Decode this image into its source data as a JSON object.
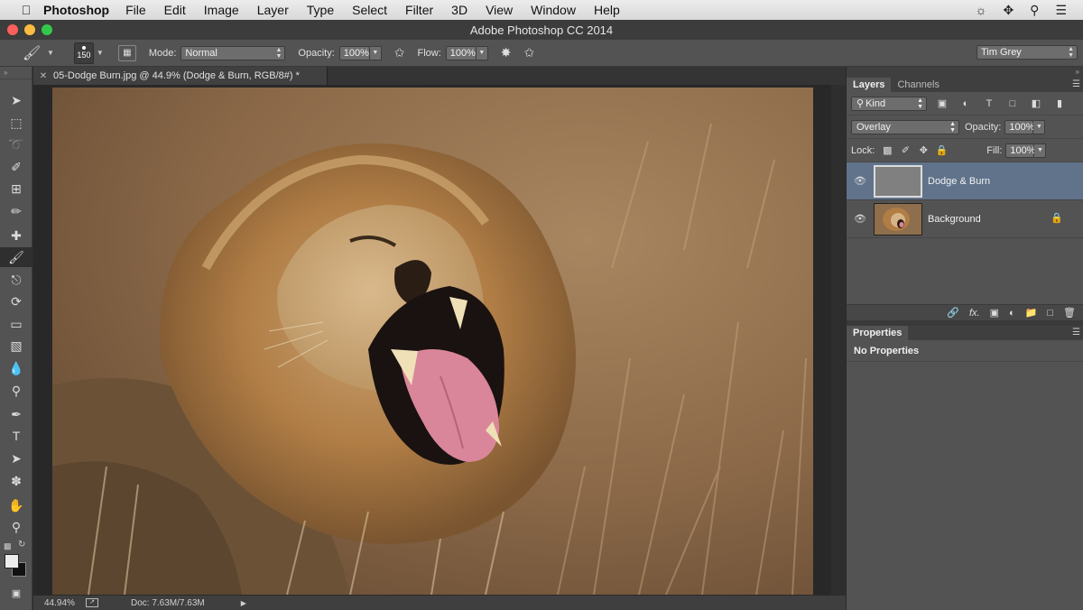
{
  "menubar": {
    "app_name": "Photoshop",
    "items": [
      "File",
      "Edit",
      "Image",
      "Layer",
      "Type",
      "Select",
      "Filter",
      "3D",
      "View",
      "Window",
      "Help"
    ]
  },
  "window": {
    "title": "Adobe Photoshop CC 2014"
  },
  "options": {
    "brush_size": "150",
    "mode_label": "Mode:",
    "mode_value": "Normal",
    "opacity_label": "Opacity:",
    "opacity_value": "100%",
    "flow_label": "Flow:",
    "flow_value": "100%",
    "workspace": "Tim Grey"
  },
  "document": {
    "tab_title": "05-Dodge Burn.jpg @ 44.9% (Dodge & Burn, RGB/8#) *",
    "zoom": "44.94%",
    "doc_size": "Doc: 7.63M/7.63M"
  },
  "layers_panel": {
    "tabs": [
      "Layers",
      "Channels"
    ],
    "kind_filter": "Kind",
    "blend_mode": "Overlay",
    "opacity_label": "Opacity:",
    "opacity_value": "100%",
    "lock_label": "Lock:",
    "fill_label": "Fill:",
    "fill_value": "100%",
    "layers": [
      {
        "name": "Dodge & Burn",
        "selected": true,
        "locked": false
      },
      {
        "name": "Background",
        "selected": false,
        "locked": true
      }
    ]
  },
  "properties_panel": {
    "tab": "Properties",
    "message": "No Properties"
  },
  "colors": {
    "selected_layer": "#60738b",
    "panel_bg": "#535353",
    "canvas_bg": "#282828"
  }
}
